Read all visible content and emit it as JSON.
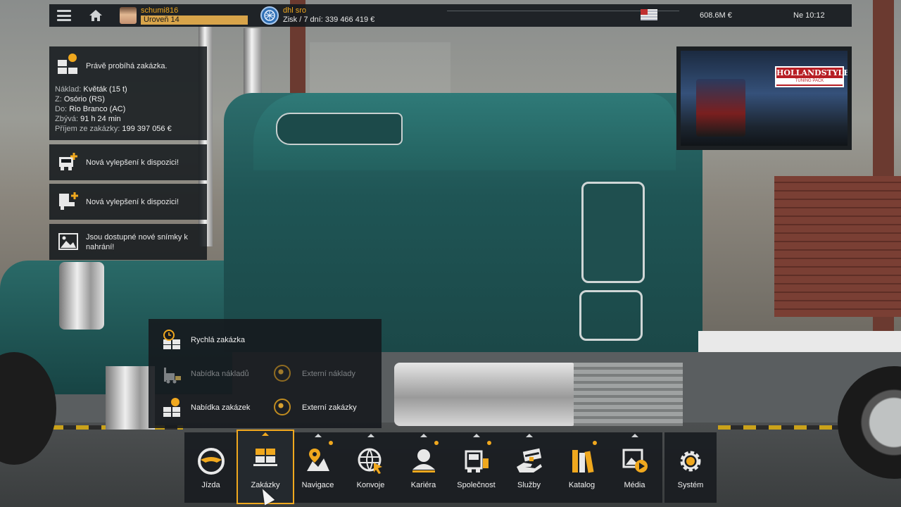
{
  "topbar": {
    "player_name": "schumi816",
    "player_level": "Úroveň 14",
    "company_name": "dhl sro",
    "company_profit": "Zisk / 7 dní: 339 466 419 €",
    "money": "608.6M  €",
    "time": "Ne 10:12"
  },
  "current_job": {
    "title": "Právě probíhá zakázka.",
    "cargo_label": "Náklad:",
    "cargo_value": "Květák (15 t)",
    "from_label": "Z:",
    "from_value": "Osório (RS)",
    "to_label": "Do:",
    "to_value": "Rio Branco (AC)",
    "remaining_label": "Zbývá:",
    "remaining_value": "91 h 24 min",
    "income_label": "Příjem ze zakázky:",
    "income_value": "199 397 056 €"
  },
  "notifications": [
    {
      "text": "Nová vylepšení k dispozici!"
    },
    {
      "text": "Nová vylepšení k dispozici!"
    },
    {
      "text": "Jsou dostupné nové snímky k nahrání!"
    }
  ],
  "preview": {
    "logo_line1": "HOLLANDSTYLE",
    "logo_line2": "TUNING PACK"
  },
  "job_menu": {
    "quick_job": "Rychlá zakázka",
    "cargo_market": "Nabídka nákladů",
    "external_cargo": "Externí náklady",
    "job_market": "Nabídka zakázek",
    "external_jobs": "Externí zakázky"
  },
  "dock": {
    "items": [
      {
        "label": "Jízda"
      },
      {
        "label": "Zakázky"
      },
      {
        "label": "Navigace"
      },
      {
        "label": "Konvoje"
      },
      {
        "label": "Kariéra"
      },
      {
        "label": "Společnost"
      },
      {
        "label": "Služby"
      },
      {
        "label": "Katalog"
      },
      {
        "label": "Média"
      }
    ],
    "system_label": "Systém"
  },
  "colors": {
    "accent": "#f0a81e",
    "panel": "#161a1e"
  }
}
